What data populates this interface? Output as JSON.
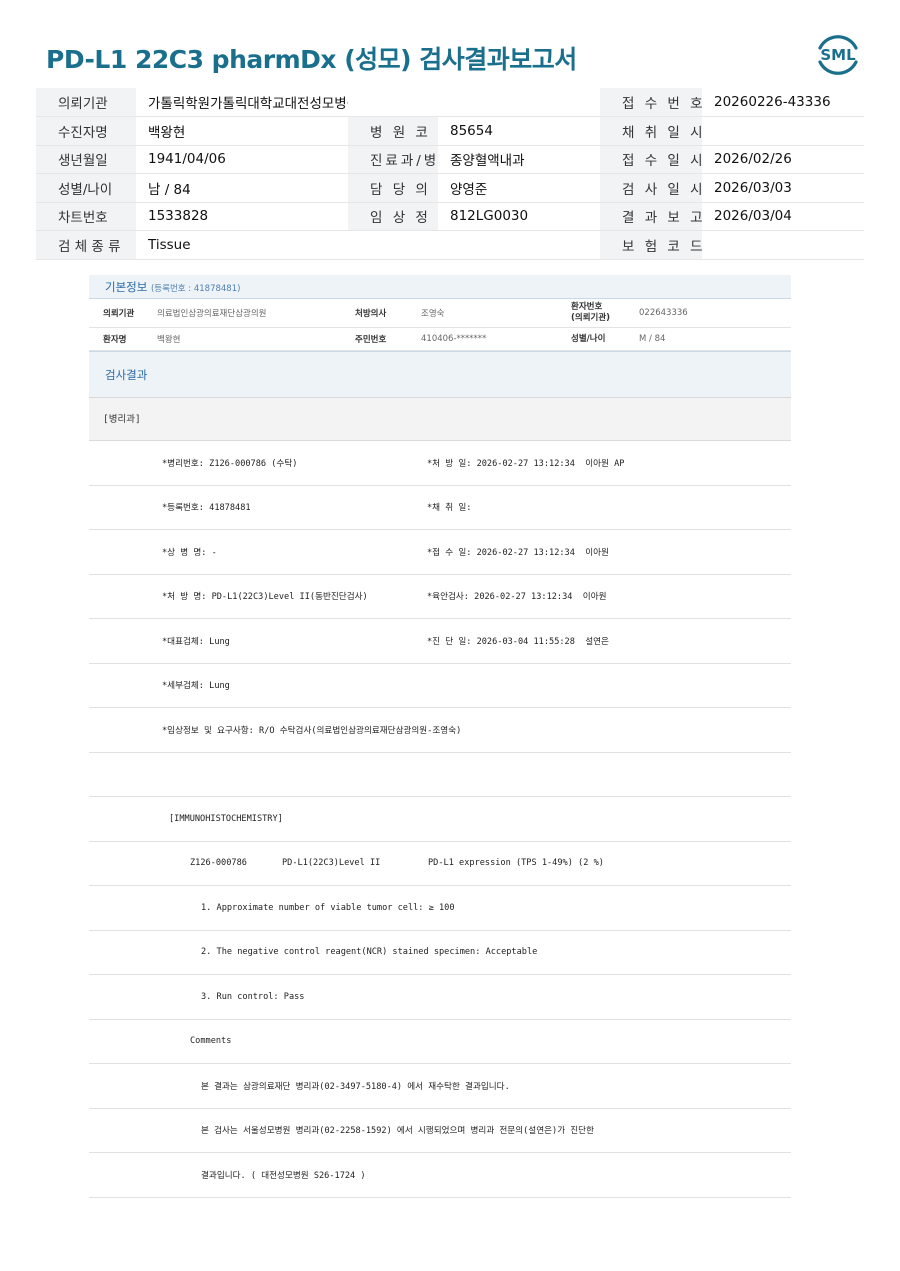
{
  "header": {
    "title": "PD-L1 22C3 pharmDx (성모) 검사결과보고서",
    "logo_text": "SML"
  },
  "info": {
    "rows": [
      {
        "l1": "의뢰기관",
        "v1": "가톨릭학원가톨릭대학교대전성모병원(병리과)",
        "l2": "",
        "v2": "",
        "l3": "접 수 번 호",
        "v3": "20260226-43336"
      },
      {
        "l1": "수진자명",
        "v1": "백왕현",
        "l2": "병 원 코 드",
        "v2": "85654",
        "l3": "채 취 일 시",
        "v3": ""
      },
      {
        "l1": "생년월일",
        "v1": "1941/04/06",
        "l2": "진료과/병동",
        "v2": "종양혈액내과",
        "l3": "접 수 일 시",
        "v3": "2026/02/26"
      },
      {
        "l1": "성별/나이",
        "v1": "남 / 84",
        "l2": "담 당 의 사",
        "v2": "양영준",
        "l3": "검 사 일 시",
        "v3": "2026/03/03"
      },
      {
        "l1": "차트번호",
        "v1": "1533828",
        "l2": "임 상 정 보",
        "v2": "812LG0030",
        "l3": "결 과 보 고",
        "v3": "2026/03/04"
      },
      {
        "l1": "검 체 종 류",
        "v1": "Tissue",
        "l2": "",
        "v2": "",
        "l3": "보 험 코 드",
        "v3": ""
      }
    ]
  },
  "basic": {
    "title": "기본정보",
    "reg": "(등록번호 : 41878481)",
    "row1": {
      "l1": "의뢰기관",
      "v1": "의료법인삼광의료재단삼광의원",
      "l2": "처방의사",
      "v2": "조영숙",
      "l3a": "환자번호",
      "l3b": "(의뢰기관)",
      "v3": "022643336"
    },
    "row2": {
      "l1": "환자명",
      "v1": "백왕현",
      "l2": "주민번호",
      "v2": "410406-*******",
      "l3": "성별/나이",
      "v3": "M / 84"
    }
  },
  "result": {
    "title": "검사결과",
    "dept": "[병리과]",
    "lines": [
      {
        "a": "*병리번호: Z126-000786 (수탁)",
        "b": "*처 방 일: 2026-02-27 13:12:34  이아원 AP"
      },
      {
        "a": "*등록번호: 41878481",
        "b": "*채 취 일:"
      },
      {
        "a": "*상 병 명: -",
        "b": "*접 수 일: 2026-02-27 13:12:34  이아원"
      },
      {
        "a": "*처 방 명: PD-L1(22C3)Level II(동반진단검사)",
        "b": "*육안검사: 2026-02-27 13:12:34  이아원"
      },
      {
        "a": "*대표검체: Lung",
        "b": "*진 단 일: 2026-03-04 11:55:28  설연은"
      },
      {
        "a": "*세부검체: Lung",
        "b": ""
      },
      {
        "a": "*임상정보 및 요구사항: R/O 수탁검사(의료법인삼광의료재단삼광의원-조영숙)",
        "b": ""
      }
    ],
    "ihc_title": "[IMMUNOHISTOCHEMISTRY]",
    "ihc_line": {
      "id": "Z126-000786",
      "test": "PD-L1(22C3)Level II",
      "result": "PD-L1 expression (TPS 1-49%) (2 %)"
    },
    "item1": "1. Approximate number of viable tumor cell: ≥ 100",
    "item2": "2. The negative control reagent(NCR) stained specimen: Acceptable",
    "item3": "3. Run control: Pass",
    "comments_label": "Comments",
    "comment1": "본 결과는 삼광의료재단 병리과(02-3497-5180-4) 에서 재수탁한 결과입니다.",
    "comment2": "본 검사는 서울성모병원 병리과(02-2258-1592) 에서 시행되었으며 병리과 전문의(설연은)가 진단한",
    "comment3": "결과입니다. ( 대전성모병원 S26-1724 )"
  }
}
